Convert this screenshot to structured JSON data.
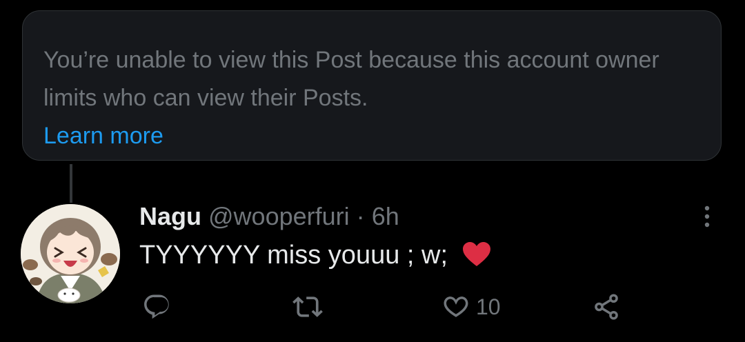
{
  "notice": {
    "message": "You’re unable to view this Post because this account owner limits who can view their Posts.",
    "link_label": "Learn more"
  },
  "post": {
    "author_name": "Nagu",
    "handle": "@wooperfuri",
    "separator": "·",
    "time": "6h",
    "text": "TYYYYYY miss youuu ; w;",
    "emoji": "red-heart-emoji",
    "avatar": "anime-character-avatar"
  },
  "actions": {
    "reply": {
      "icon": "reply-icon",
      "count": ""
    },
    "repost": {
      "icon": "repost-icon",
      "count": ""
    },
    "like": {
      "icon": "heart-icon",
      "count": "10"
    },
    "share": {
      "icon": "share-icon",
      "count": ""
    },
    "more": {
      "icon": "more-dots-icon"
    }
  },
  "colors": {
    "background": "#000000",
    "card_background": "#16181c",
    "muted_text": "#71767b",
    "primary_text": "#e7e9ea",
    "link": "#1d9bf0",
    "emoji_heart": "#dd2e44"
  }
}
